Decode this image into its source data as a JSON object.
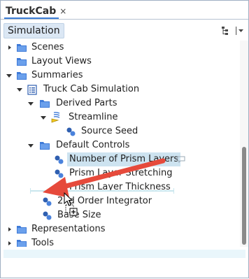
{
  "tab": {
    "title": "TruckCab",
    "close": "×"
  },
  "toolbar": {
    "simulation": "Simulation"
  },
  "tree": {
    "scenes": "Scenes",
    "layout_views": "Layout Views",
    "summaries": "Summaries",
    "truck_cab_simulation": "Truck Cab Simulation",
    "derived_parts": "Derived Parts",
    "streamline": "Streamline",
    "source_seed": "Source Seed",
    "default_controls": "Default Controls",
    "number_of_prism_layers": "Number of Prism Layers",
    "prism_layer_stretching": "Prism Layer Stretching",
    "prism_layer_thickness": "Prism Layer Thickness",
    "second_order_integrator": "2nd Order Integrator",
    "base_size": "Base Size",
    "representations": "Representations",
    "tools": "Tools"
  },
  "colors": {
    "accent": "#3e7fd6",
    "arrow": "#e64a3b",
    "folder": "#3f7bd8"
  }
}
